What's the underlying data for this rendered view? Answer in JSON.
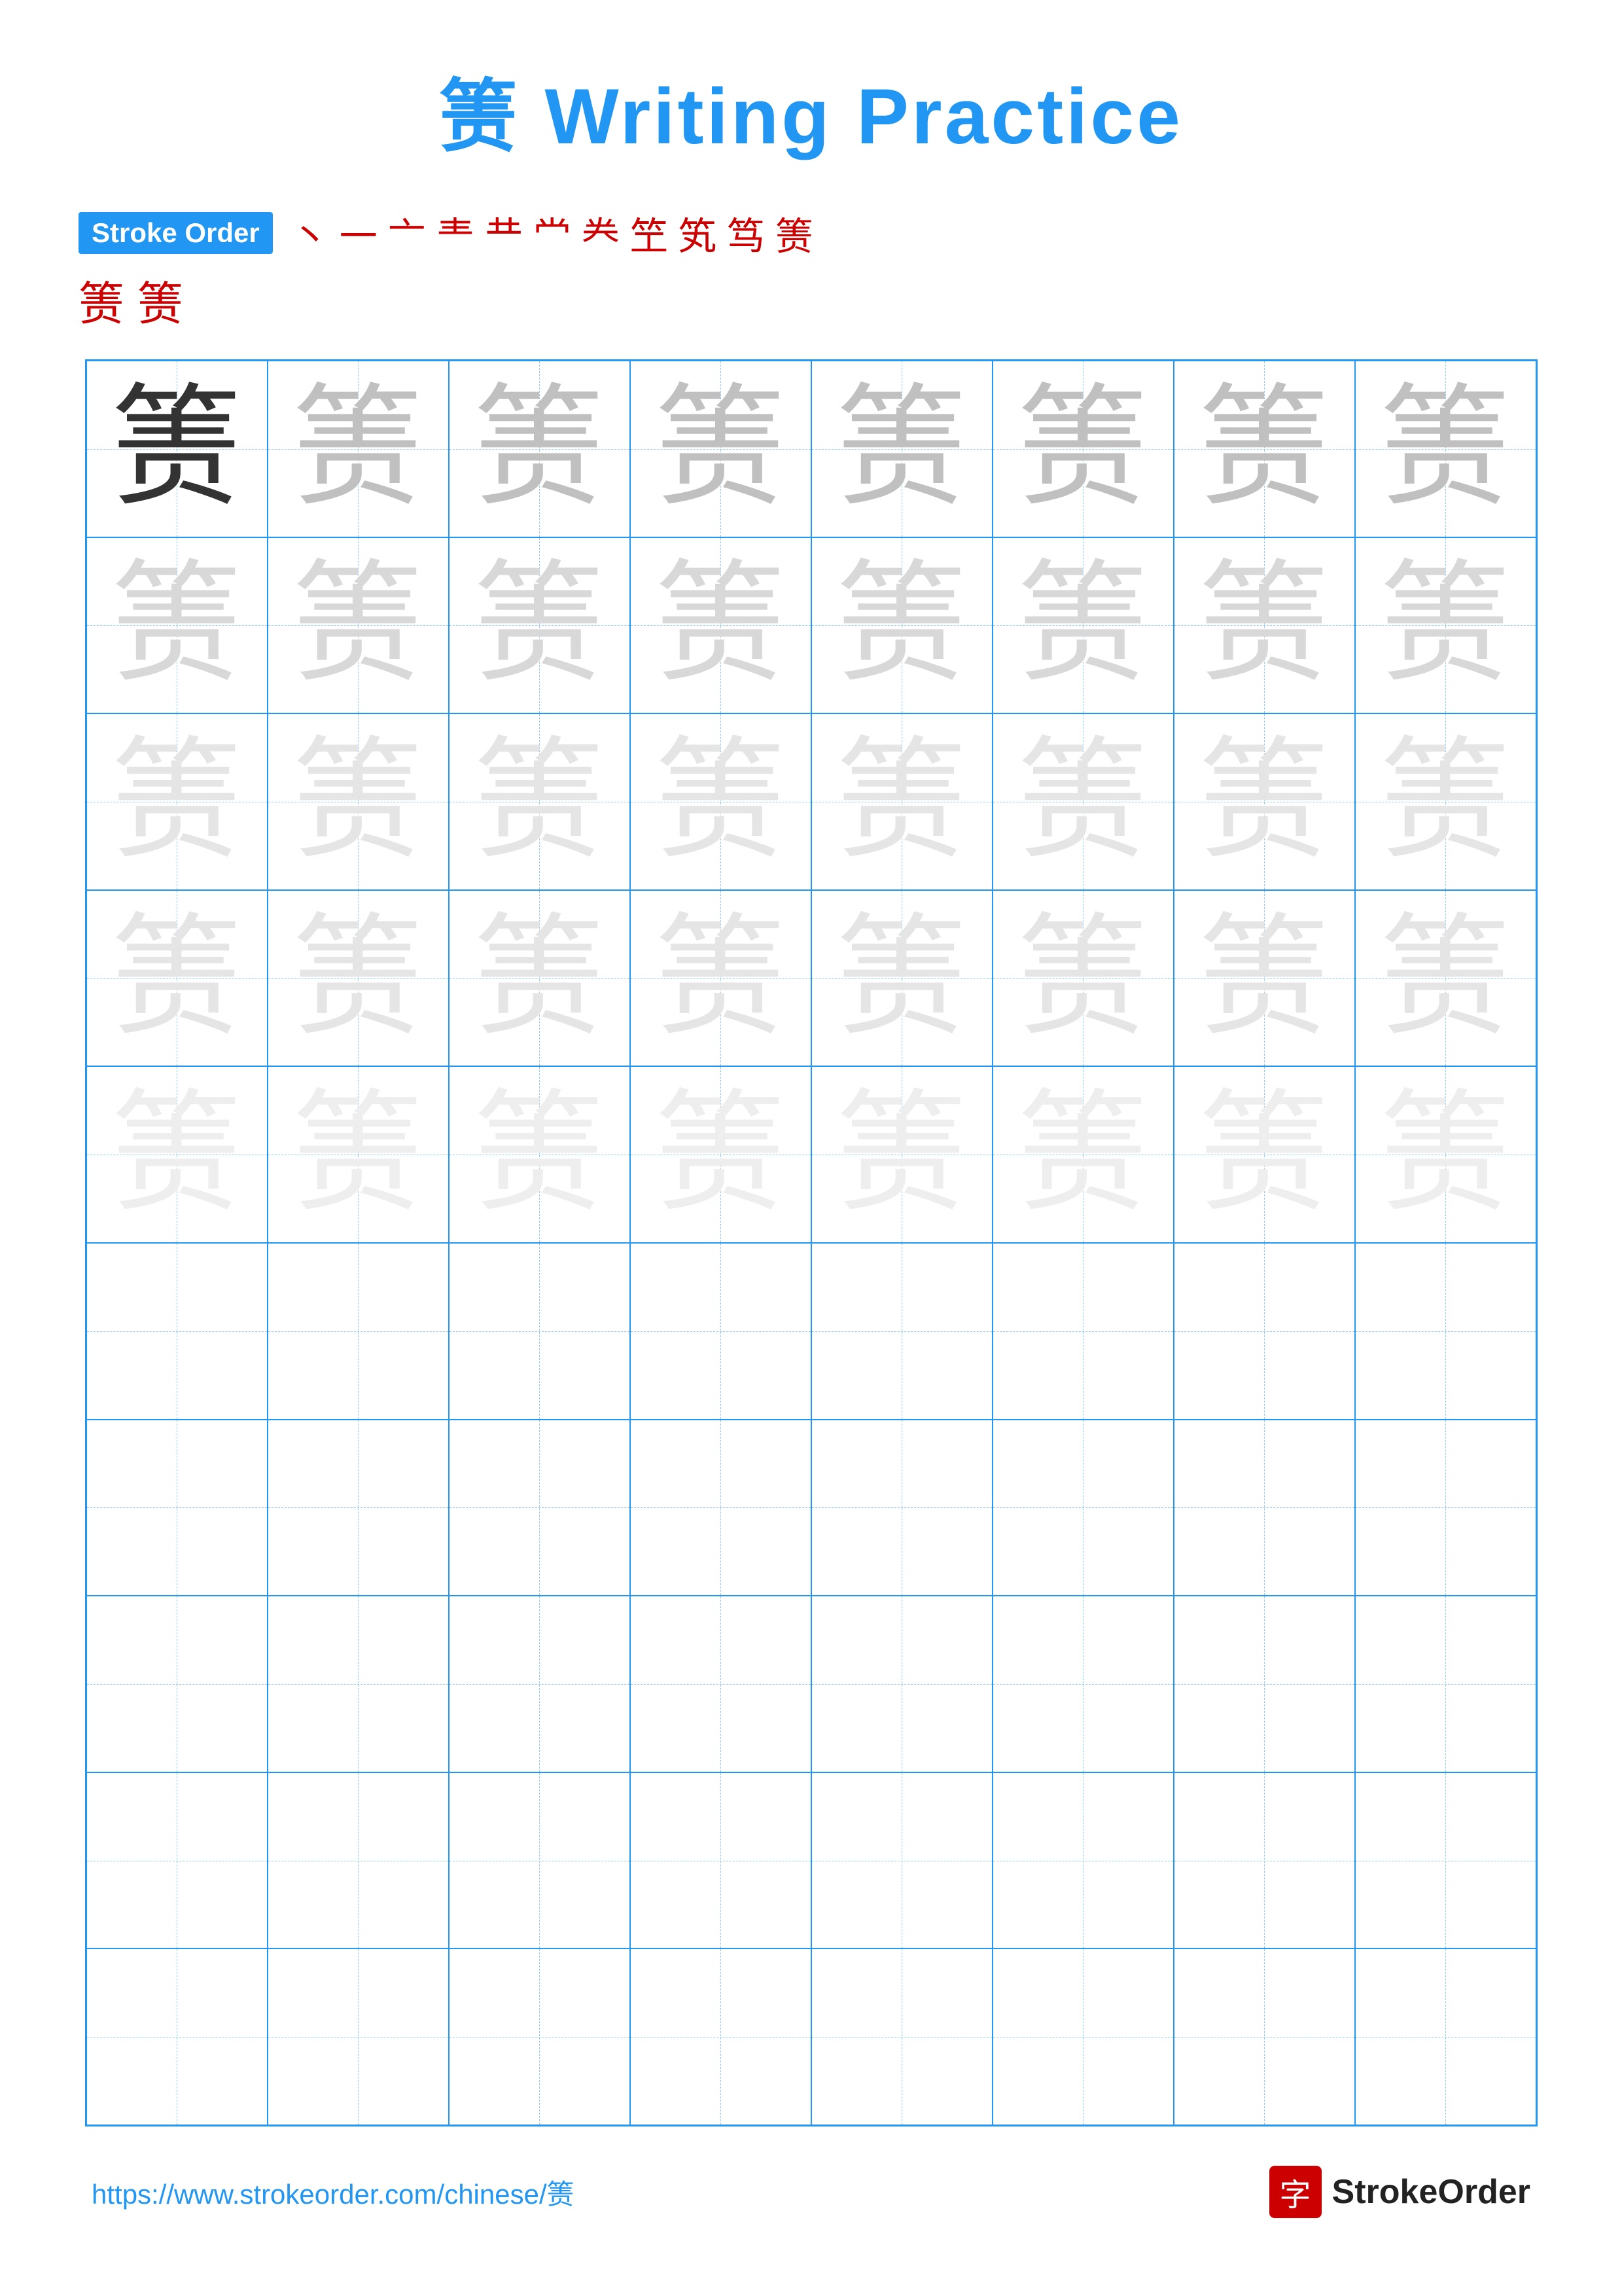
{
  "page": {
    "title": "箦 Writing Practice",
    "title_chinese": "箦",
    "title_english": " Writing Practice",
    "stroke_order_label": "Stroke Order",
    "stroke_sequence": [
      "丶",
      "一",
      "亠",
      "龶",
      "龷",
      "龸",
      "龹",
      "笁",
      "笂",
      "笃",
      "箦",
      "箦",
      "箦"
    ],
    "stroke_row1": [
      "丶",
      "一",
      "亠",
      "龶",
      "龷",
      "龸",
      "龹",
      "笁",
      "笂",
      "笃",
      "箦"
    ],
    "stroke_row2": [
      "箦",
      "箦"
    ],
    "grid_char": "箦",
    "rows": 10,
    "cols": 8,
    "footer_url": "https://www.strokeorder.com/chinese/箦",
    "footer_brand": "StrokeOrder",
    "footer_brand_char": "字"
  }
}
